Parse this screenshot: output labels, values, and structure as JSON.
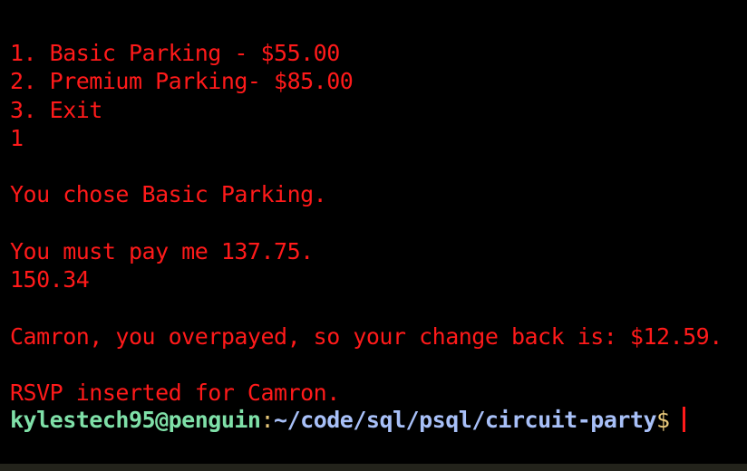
{
  "terminal": {
    "output_lines": [
      "1. Basic Parking - $55.00",
      "2. Premium Parking- $85.00",
      "3. Exit",
      "1",
      "",
      "You chose Basic Parking.",
      "",
      "You must pay me 137.75.",
      "150.34",
      "",
      "Camron, you overpayed, so your change back is: $12.59.",
      "",
      "RSVP inserted for Camron."
    ],
    "prompt": {
      "user_host": "kylestech95@penguin",
      "colon": ":",
      "path": "~/code/sql/psql/circuit-party",
      "dollar": "$"
    }
  },
  "colors": {
    "output": "#ff1a1a",
    "user_host": "#7fe0a8",
    "path": "#a8c0f8",
    "separator": "#e8c87a",
    "background": "#000000"
  }
}
